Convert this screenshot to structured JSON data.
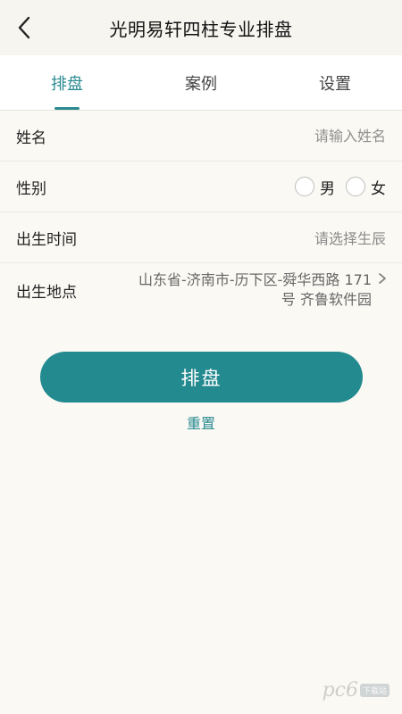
{
  "header": {
    "title": "光明易轩四柱专业排盘",
    "back_icon": "chevron-left-icon"
  },
  "tabs": [
    {
      "label": "排盘",
      "active": true
    },
    {
      "label": "案例",
      "active": false
    },
    {
      "label": "设置",
      "active": false
    }
  ],
  "form": {
    "name": {
      "label": "姓名",
      "value": "",
      "placeholder": "请输入姓名"
    },
    "gender": {
      "label": "性别",
      "options": [
        "男",
        "女"
      ],
      "selected": null
    },
    "birth_time": {
      "label": "出生时间",
      "value": "请选择生辰"
    },
    "birth_place": {
      "label": "出生地点",
      "value": "山东省-济南市-历下区-舜华西路 171号 齐鲁软件园"
    }
  },
  "actions": {
    "submit_label": "排盘",
    "reset_label": "重置"
  },
  "watermark": {
    "text": "pc6",
    "badge": "下载站"
  },
  "colors": {
    "accent": "#238a8f",
    "background": "#fbf9f4",
    "header_background": "#f7f5f0"
  }
}
